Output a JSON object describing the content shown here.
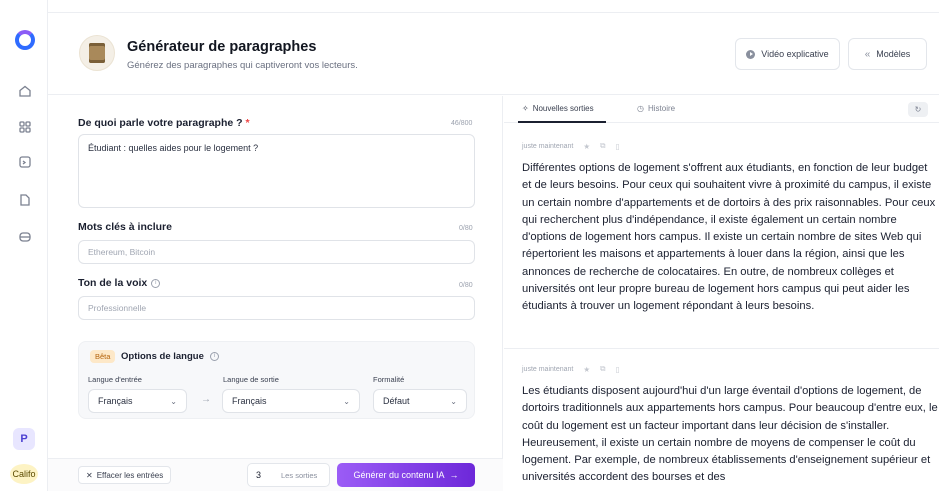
{
  "app": {
    "page_title": "Générateur de paragraphes",
    "page_subtitle": "Générez des paragraphes qui captiveront vos lecteurs.",
    "video_button": "Vidéo explicative",
    "models_button": "Modèles"
  },
  "sidebar": {
    "icons": [
      "home-icon",
      "grid-icon",
      "template-icon",
      "document-icon",
      "folder-icon"
    ],
    "avatar_initial": "P",
    "workspace_label": "Califo"
  },
  "form": {
    "topic_label": "De quoi parle votre paragraphe ?",
    "topic_required": "*",
    "topic_counter": "46/800",
    "topic_value": "Étudiant : quelles aides pour le logement ?",
    "keywords_label": "Mots clés à inclure",
    "keywords_counter": "0/80",
    "keywords_placeholder": "Ethereum, Bitcoin",
    "tone_label": "Ton de la voix",
    "tone_counter": "0/80",
    "tone_placeholder": "Professionnelle",
    "language_box": {
      "beta": "Bêta",
      "title": "Options de langue",
      "input_lang_label": "Langue d'entrée",
      "input_lang_value": "Français",
      "output_lang_label": "Langue de sortie",
      "output_lang_value": "Français",
      "formality_label": "Formalité",
      "formality_value": "Défaut"
    },
    "clear_button": "Effacer les entrées",
    "outputs_count": "3",
    "outputs_label": "Les sorties",
    "generate_button": "Générer du contenu IA"
  },
  "output": {
    "tab_new": "Nouvelles sorties",
    "tab_history": "Histoire",
    "results": [
      {
        "time": "juste maintenant",
        "text": "Différentes options de logement s'offrent aux étudiants, en fonction de leur budget et de leurs besoins. Pour ceux qui souhaitent vivre à proximité du campus, il existe un certain nombre d'appartements et de dortoirs à des prix raisonnables. Pour ceux qui recherchent plus d'indépendance, il existe également un certain nombre d'options de logement hors campus. Il existe un certain nombre de sites Web qui répertorient les maisons et appartements à louer dans la région, ainsi que les annonces de recherche de colocataires. En outre, de nombreux collèges et universités ont leur propre bureau de logement hors campus qui peut aider les étudiants à trouver un logement répondant à leurs besoins."
      },
      {
        "time": "juste maintenant",
        "text": "Les étudiants disposent aujourd'hui d'un large éventail d'options de logement, de dortoirs traditionnels aux appartements hors campus. Pour beaucoup d'entre eux, le coût du logement est un facteur important dans leur décision de s'installer. Heureusement, il existe un certain nombre de moyens de compenser le coût du logement. Par exemple, de nombreux établissements d'enseignement supérieur et universités accordent des bourses et des"
      }
    ]
  },
  "colors": {
    "accent_gradient_start": "#9b5cf6",
    "accent_gradient_end": "#6d28d9",
    "required": "#ef4444",
    "beta_bg": "#fde8c8"
  }
}
